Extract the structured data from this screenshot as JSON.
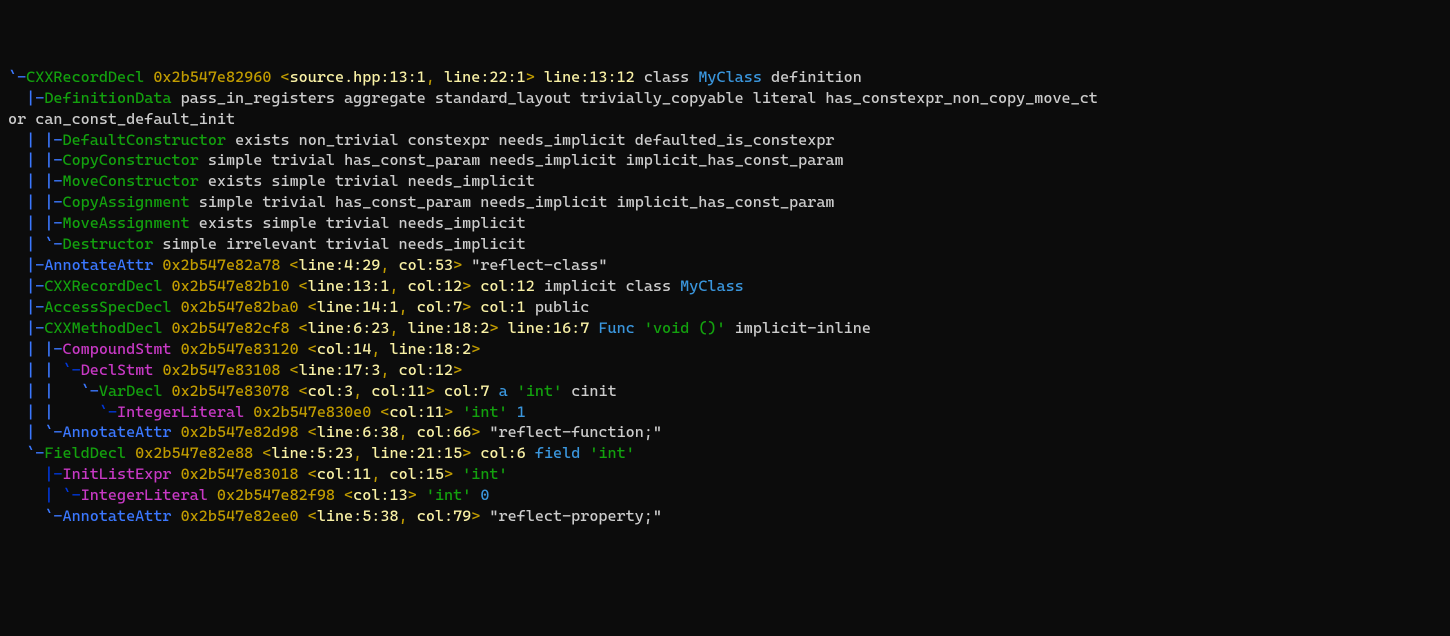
{
  "lines": [
    {
      "segments": [
        {
          "t": "`-",
          "c": "b"
        },
        {
          "t": "CXXRecordDecl",
          "c": "g"
        },
        {
          "t": " 0x2b547e82960 ",
          "c": "y"
        },
        {
          "t": "<",
          "c": "lo"
        },
        {
          "t": "source.hpp:13:1",
          "c": "o"
        },
        {
          "t": ", ",
          "c": "lo"
        },
        {
          "t": "line:22:1",
          "c": "o"
        },
        {
          "t": ">",
          "c": "lo"
        },
        {
          "t": " ",
          "c": "gr"
        },
        {
          "t": "line:13:12",
          "c": "o"
        },
        {
          "t": " class ",
          "c": "gr"
        },
        {
          "t": "MyClass",
          "c": "cy"
        },
        {
          "t": " definition",
          "c": "gr"
        }
      ]
    },
    {
      "segments": [
        {
          "t": "  |-",
          "c": "b"
        },
        {
          "t": "DefinitionData",
          "c": "g"
        },
        {
          "t": " pass_in_registers aggregate standard_layout trivially_copyable literal has_constexpr_non_copy_move_ct",
          "c": "gr"
        }
      ]
    },
    {
      "segments": [
        {
          "t": "or can_const_default_init",
          "c": "gr"
        }
      ]
    },
    {
      "segments": [
        {
          "t": "  |",
          "c": "b"
        },
        {
          "t": " ",
          "c": "gr"
        },
        {
          "t": "|-",
          "c": "b"
        },
        {
          "t": "DefaultConstructor",
          "c": "g"
        },
        {
          "t": " exists non_trivial constexpr needs_implicit defaulted_is_constexpr",
          "c": "gr"
        }
      ]
    },
    {
      "segments": [
        {
          "t": "  |",
          "c": "b"
        },
        {
          "t": " ",
          "c": "gr"
        },
        {
          "t": "|-",
          "c": "b"
        },
        {
          "t": "CopyConstructor",
          "c": "g"
        },
        {
          "t": " simple trivial has_const_param needs_implicit implicit_has_const_param",
          "c": "gr"
        }
      ]
    },
    {
      "segments": [
        {
          "t": "  |",
          "c": "b"
        },
        {
          "t": " ",
          "c": "gr"
        },
        {
          "t": "|-",
          "c": "b"
        },
        {
          "t": "MoveConstructor",
          "c": "g"
        },
        {
          "t": " exists simple trivial needs_implicit",
          "c": "gr"
        }
      ]
    },
    {
      "segments": [
        {
          "t": "  |",
          "c": "b"
        },
        {
          "t": " ",
          "c": "gr"
        },
        {
          "t": "|-",
          "c": "b"
        },
        {
          "t": "CopyAssignment",
          "c": "g"
        },
        {
          "t": " simple trivial has_const_param needs_implicit implicit_has_const_param",
          "c": "gr"
        }
      ]
    },
    {
      "segments": [
        {
          "t": "  |",
          "c": "b"
        },
        {
          "t": " ",
          "c": "gr"
        },
        {
          "t": "|-",
          "c": "b"
        },
        {
          "t": "MoveAssignment",
          "c": "g"
        },
        {
          "t": " exists simple trivial needs_implicit",
          "c": "gr"
        }
      ]
    },
    {
      "segments": [
        {
          "t": "  |",
          "c": "b"
        },
        {
          "t": " ",
          "c": "gr"
        },
        {
          "t": "`-",
          "c": "b"
        },
        {
          "t": "Destructor",
          "c": "g"
        },
        {
          "t": " simple irrelevant trivial needs_implicit",
          "c": "gr"
        }
      ]
    },
    {
      "segments": [
        {
          "t": "  |-",
          "c": "b"
        },
        {
          "t": "AnnotateAttr",
          "c": "b"
        },
        {
          "t": " 0x2b547e82a78 ",
          "c": "y"
        },
        {
          "t": "<",
          "c": "lo"
        },
        {
          "t": "line:4:29",
          "c": "o"
        },
        {
          "t": ", ",
          "c": "lo"
        },
        {
          "t": "col:53",
          "c": "o"
        },
        {
          "t": ">",
          "c": "lo"
        },
        {
          "t": " \"reflect-class\"",
          "c": "gr"
        }
      ]
    },
    {
      "segments": [
        {
          "t": "  |-",
          "c": "b"
        },
        {
          "t": "CXXRecordDecl",
          "c": "g"
        },
        {
          "t": " 0x2b547e82b10 ",
          "c": "y"
        },
        {
          "t": "<",
          "c": "lo"
        },
        {
          "t": "line:13:1",
          "c": "o"
        },
        {
          "t": ", ",
          "c": "lo"
        },
        {
          "t": "col:12",
          "c": "o"
        },
        {
          "t": ">",
          "c": "lo"
        },
        {
          "t": " ",
          "c": "gr"
        },
        {
          "t": "col:12",
          "c": "o"
        },
        {
          "t": " implicit class ",
          "c": "gr"
        },
        {
          "t": "MyClass",
          "c": "cy"
        }
      ]
    },
    {
      "segments": [
        {
          "t": "  |-",
          "c": "b"
        },
        {
          "t": "AccessSpecDecl",
          "c": "g"
        },
        {
          "t": " 0x2b547e82ba0 ",
          "c": "y"
        },
        {
          "t": "<",
          "c": "lo"
        },
        {
          "t": "line:14:1",
          "c": "o"
        },
        {
          "t": ", ",
          "c": "lo"
        },
        {
          "t": "col:7",
          "c": "o"
        },
        {
          "t": ">",
          "c": "lo"
        },
        {
          "t": " ",
          "c": "gr"
        },
        {
          "t": "col:1",
          "c": "o"
        },
        {
          "t": " public",
          "c": "gr"
        }
      ]
    },
    {
      "segments": [
        {
          "t": "  |-",
          "c": "b"
        },
        {
          "t": "CXXMethodDecl",
          "c": "g"
        },
        {
          "t": " 0x2b547e82cf8 ",
          "c": "y"
        },
        {
          "t": "<",
          "c": "lo"
        },
        {
          "t": "line:6:23",
          "c": "o"
        },
        {
          "t": ", ",
          "c": "lo"
        },
        {
          "t": "line:18:2",
          "c": "o"
        },
        {
          "t": ">",
          "c": "lo"
        },
        {
          "t": " ",
          "c": "gr"
        },
        {
          "t": "line:16:7",
          "c": "o"
        },
        {
          "t": " ",
          "c": "gr"
        },
        {
          "t": "Func",
          "c": "cy"
        },
        {
          "t": " ",
          "c": "gr"
        },
        {
          "t": "'void ()'",
          "c": "g"
        },
        {
          "t": " implicit-inline",
          "c": "gr"
        }
      ]
    },
    {
      "segments": [
        {
          "t": "  |",
          "c": "b"
        },
        {
          "t": " ",
          "c": "gr"
        },
        {
          "t": "|-",
          "c": "b"
        },
        {
          "t": "CompoundStmt",
          "c": "m"
        },
        {
          "t": " 0x2b547e83120 ",
          "c": "y"
        },
        {
          "t": "<",
          "c": "lo"
        },
        {
          "t": "col:14",
          "c": "o"
        },
        {
          "t": ", ",
          "c": "lo"
        },
        {
          "t": "line:18:2",
          "c": "o"
        },
        {
          "t": ">",
          "c": "lo"
        }
      ]
    },
    {
      "segments": [
        {
          "t": "  |",
          "c": "b"
        },
        {
          "t": " ",
          "c": "gr"
        },
        {
          "t": "|",
          "c": "b"
        },
        {
          "t": " ",
          "c": "gr"
        },
        {
          "t": "`-",
          "c": "bl2"
        },
        {
          "t": "DeclStmt",
          "c": "m"
        },
        {
          "t": " 0x2b547e83108 ",
          "c": "y"
        },
        {
          "t": "<",
          "c": "lo"
        },
        {
          "t": "line:17:3",
          "c": "o"
        },
        {
          "t": ", ",
          "c": "lo"
        },
        {
          "t": "col:12",
          "c": "o"
        },
        {
          "t": ">",
          "c": "lo"
        }
      ]
    },
    {
      "segments": [
        {
          "t": "  |",
          "c": "b"
        },
        {
          "t": " ",
          "c": "gr"
        },
        {
          "t": "|",
          "c": "b"
        },
        {
          "t": "   ",
          "c": "gr"
        },
        {
          "t": "`-",
          "c": "b"
        },
        {
          "t": "VarDecl",
          "c": "g"
        },
        {
          "t": " 0x2b547e83078 ",
          "c": "y"
        },
        {
          "t": "<",
          "c": "lo"
        },
        {
          "t": "col:3",
          "c": "o"
        },
        {
          "t": ", ",
          "c": "lo"
        },
        {
          "t": "col:11",
          "c": "o"
        },
        {
          "t": ">",
          "c": "lo"
        },
        {
          "t": " ",
          "c": "gr"
        },
        {
          "t": "col:7",
          "c": "o"
        },
        {
          "t": " ",
          "c": "gr"
        },
        {
          "t": "a",
          "c": "cy"
        },
        {
          "t": " ",
          "c": "gr"
        },
        {
          "t": "'int'",
          "c": "g"
        },
        {
          "t": " cinit",
          "c": "gr"
        }
      ]
    },
    {
      "segments": [
        {
          "t": "  |",
          "c": "b"
        },
        {
          "t": " ",
          "c": "gr"
        },
        {
          "t": "|",
          "c": "b"
        },
        {
          "t": "     ",
          "c": "gr"
        },
        {
          "t": "`-",
          "c": "bl2"
        },
        {
          "t": "IntegerLiteral",
          "c": "m"
        },
        {
          "t": " 0x2b547e830e0 ",
          "c": "y"
        },
        {
          "t": "<",
          "c": "lo"
        },
        {
          "t": "col:11",
          "c": "o"
        },
        {
          "t": ">",
          "c": "lo"
        },
        {
          "t": " ",
          "c": "gr"
        },
        {
          "t": "'int'",
          "c": "g"
        },
        {
          "t": " ",
          "c": "gr"
        },
        {
          "t": "1",
          "c": "cy"
        }
      ]
    },
    {
      "segments": [
        {
          "t": "  |",
          "c": "b"
        },
        {
          "t": " ",
          "c": "gr"
        },
        {
          "t": "`-",
          "c": "b"
        },
        {
          "t": "AnnotateAttr",
          "c": "b"
        },
        {
          "t": " 0x2b547e82d98 ",
          "c": "y"
        },
        {
          "t": "<",
          "c": "lo"
        },
        {
          "t": "line:6:38",
          "c": "o"
        },
        {
          "t": ", ",
          "c": "lo"
        },
        {
          "t": "col:66",
          "c": "o"
        },
        {
          "t": ">",
          "c": "lo"
        },
        {
          "t": " \"reflect-function;\"",
          "c": "gr"
        }
      ]
    },
    {
      "segments": [
        {
          "t": "  `-",
          "c": "b"
        },
        {
          "t": "FieldDecl",
          "c": "g"
        },
        {
          "t": " 0x2b547e82e88 ",
          "c": "y"
        },
        {
          "t": "<",
          "c": "lo"
        },
        {
          "t": "line:5:23",
          "c": "o"
        },
        {
          "t": ", ",
          "c": "lo"
        },
        {
          "t": "line:21:15",
          "c": "o"
        },
        {
          "t": ">",
          "c": "lo"
        },
        {
          "t": " ",
          "c": "gr"
        },
        {
          "t": "col:6",
          "c": "o"
        },
        {
          "t": " ",
          "c": "gr"
        },
        {
          "t": "field",
          "c": "cy"
        },
        {
          "t": " ",
          "c": "gr"
        },
        {
          "t": "'int'",
          "c": "g"
        }
      ]
    },
    {
      "segments": [
        {
          "t": "    |-",
          "c": "bl2"
        },
        {
          "t": "InitListExpr",
          "c": "m"
        },
        {
          "t": " 0x2b547e83018 ",
          "c": "y"
        },
        {
          "t": "<",
          "c": "lo"
        },
        {
          "t": "col:11",
          "c": "o"
        },
        {
          "t": ", ",
          "c": "lo"
        },
        {
          "t": "col:15",
          "c": "o"
        },
        {
          "t": ">",
          "c": "lo"
        },
        {
          "t": " ",
          "c": "gr"
        },
        {
          "t": "'int'",
          "c": "g"
        }
      ]
    },
    {
      "segments": [
        {
          "t": "    |",
          "c": "bl2"
        },
        {
          "t": " ",
          "c": "gr"
        },
        {
          "t": "`-",
          "c": "bl2"
        },
        {
          "t": "IntegerLiteral",
          "c": "m"
        },
        {
          "t": " 0x2b547e82f98 ",
          "c": "y"
        },
        {
          "t": "<",
          "c": "lo"
        },
        {
          "t": "col:13",
          "c": "o"
        },
        {
          "t": ">",
          "c": "lo"
        },
        {
          "t": " ",
          "c": "gr"
        },
        {
          "t": "'int'",
          "c": "g"
        },
        {
          "t": " ",
          "c": "gr"
        },
        {
          "t": "0",
          "c": "cy"
        }
      ]
    },
    {
      "segments": [
        {
          "t": "    `-",
          "c": "b"
        },
        {
          "t": "AnnotateAttr",
          "c": "b"
        },
        {
          "t": " 0x2b547e82ee0 ",
          "c": "y"
        },
        {
          "t": "<",
          "c": "lo"
        },
        {
          "t": "line:5:38",
          "c": "o"
        },
        {
          "t": ", ",
          "c": "lo"
        },
        {
          "t": "col:79",
          "c": "o"
        },
        {
          "t": ">",
          "c": "lo"
        },
        {
          "t": " \"reflect-property;\"",
          "c": "gr"
        }
      ]
    }
  ]
}
